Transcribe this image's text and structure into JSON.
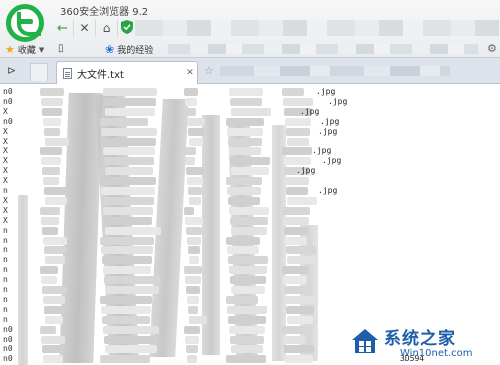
{
  "window": {
    "title": "360安全浏览器 9.2"
  },
  "bookmarks": {
    "favorites_label": "收藏",
    "link_label": "我的经验"
  },
  "tab": {
    "title": "大文件.txt"
  },
  "file_lines": [
    {
      "prefix": "n0",
      "fname": ".jpg"
    },
    {
      "prefix": "n0",
      "fname": ".jpg"
    },
    {
      "prefix": "X",
      "fname": ".jpg"
    },
    {
      "prefix": "n0",
      "fname": ".jpg"
    },
    {
      "prefix": "X",
      "fname": ".jpg"
    },
    {
      "prefix": "X",
      "fname": ""
    },
    {
      "prefix": "X",
      "fname": ".jpg"
    },
    {
      "prefix": "X",
      "fname": ".jpg"
    },
    {
      "prefix": "X",
      "fname": ".jpg"
    },
    {
      "prefix": "X",
      "fname": ""
    },
    {
      "prefix": "n",
      "fname": ".jpg"
    },
    {
      "prefix": "X",
      "fname": ""
    },
    {
      "prefix": "X",
      "fname": ""
    },
    {
      "prefix": "X",
      "fname": ""
    },
    {
      "prefix": "n",
      "fname": ""
    },
    {
      "prefix": "n",
      "fname": ""
    },
    {
      "prefix": "n",
      "fname": ""
    },
    {
      "prefix": "n",
      "fname": ""
    },
    {
      "prefix": "n",
      "fname": ""
    },
    {
      "prefix": "n",
      "fname": ""
    },
    {
      "prefix": "n",
      "fname": ""
    },
    {
      "prefix": "n",
      "fname": ""
    },
    {
      "prefix": "n",
      "fname": ""
    },
    {
      "prefix": "n",
      "fname": ""
    },
    {
      "prefix": "n0",
      "fname": ""
    },
    {
      "prefix": "n0",
      "fname": ""
    },
    {
      "prefix": "n0",
      "fname": ""
    },
    {
      "prefix": "n0",
      "fname": "3D594"
    }
  ],
  "watermark": {
    "title": "系统之家",
    "subtitle": "Win10net.com"
  },
  "colors": {
    "accent": "#23b24a",
    "watermark": "#1e5faa"
  }
}
